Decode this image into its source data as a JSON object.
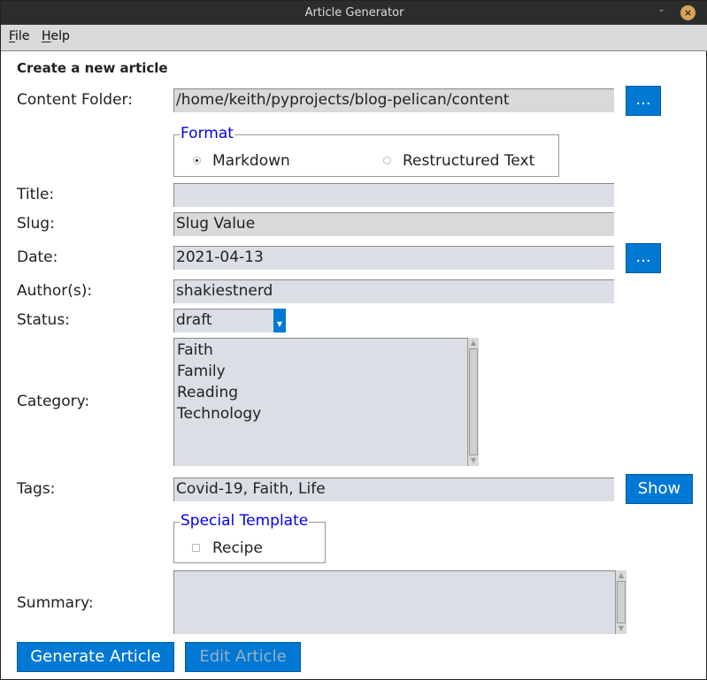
{
  "window": {
    "title": "Article Generator",
    "minimize": "-",
    "close": "×"
  },
  "menu": [
    {
      "label": "File",
      "mnemonic": "F",
      "rest": "ile"
    },
    {
      "label": "Help",
      "mnemonic": "H",
      "rest": "elp"
    }
  ],
  "heading": "Create a new article",
  "content_folder": {
    "label": "Content Folder:",
    "value": "/home/keith/pyprojects/blog-pelican/content",
    "button": "..."
  },
  "format": {
    "legend": "Format",
    "options": [
      {
        "label": "Markdown",
        "selected": true
      },
      {
        "label": "Restructured Text",
        "selected": false
      }
    ]
  },
  "title": {
    "label": "Title:",
    "value": ""
  },
  "slug": {
    "label": "Slug:",
    "value": "Slug Value"
  },
  "date": {
    "label": "Date:",
    "value": "2021-04-13",
    "button": "..."
  },
  "author": {
    "label": "Author(s):",
    "value": "shakiestnerd"
  },
  "status": {
    "label": "Status:",
    "value": "draft"
  },
  "category": {
    "label": "Category:",
    "items": [
      "Faith",
      "Family",
      "Reading",
      "Technology"
    ]
  },
  "tags": {
    "label": "Tags:",
    "value": "Covid-19, Faith, Life",
    "button": "Show"
  },
  "special_template": {
    "legend": "Special Template",
    "option": "Recipe",
    "checked": false
  },
  "summary": {
    "label": "Summary:",
    "value": ""
  },
  "actions": {
    "generate": "Generate Article",
    "edit": "Edit Article",
    "edit_enabled": false
  },
  "colors": {
    "accent": "#0078d4",
    "legend": "#0000ee",
    "entry_bg": "#dadee5",
    "readonly_bg": "#d9d9d9"
  }
}
